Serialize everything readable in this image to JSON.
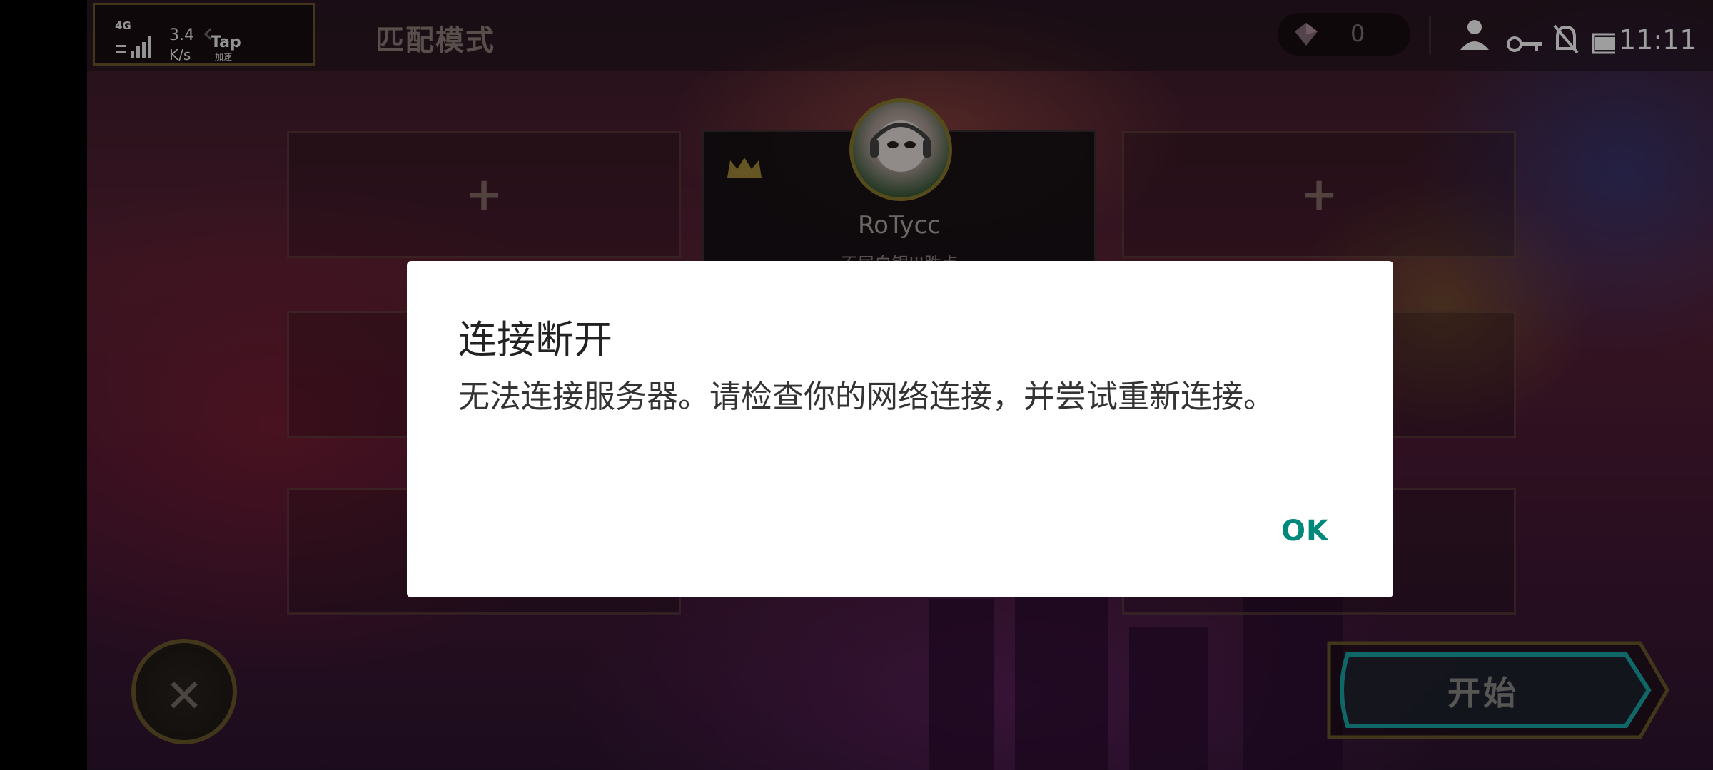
{
  "status_bar": {
    "network_type": "4G",
    "speed_value": "3.4",
    "speed_unit": "K/s",
    "tap_label": "Tap",
    "tap_sub": "加速",
    "time": "11:11"
  },
  "header": {
    "mode_title": "匹配模式",
    "currency_value": "0"
  },
  "party": {
    "empty_slot_symbol": "+",
    "leader": {
      "name": "RoTycc",
      "rank": "不屈白银III胜点"
    }
  },
  "dialog": {
    "title": "连接断开",
    "message": "无法连接服务器。请检查你的网络连接，并尝试重新连接。",
    "ok_label": "OK"
  },
  "controls": {
    "close_glyph": "✕",
    "start_label": "开始"
  },
  "colors": {
    "accent_ok": "#00897b",
    "gold_border": "#6b5a2a",
    "start_border": "#1aa7a8"
  }
}
